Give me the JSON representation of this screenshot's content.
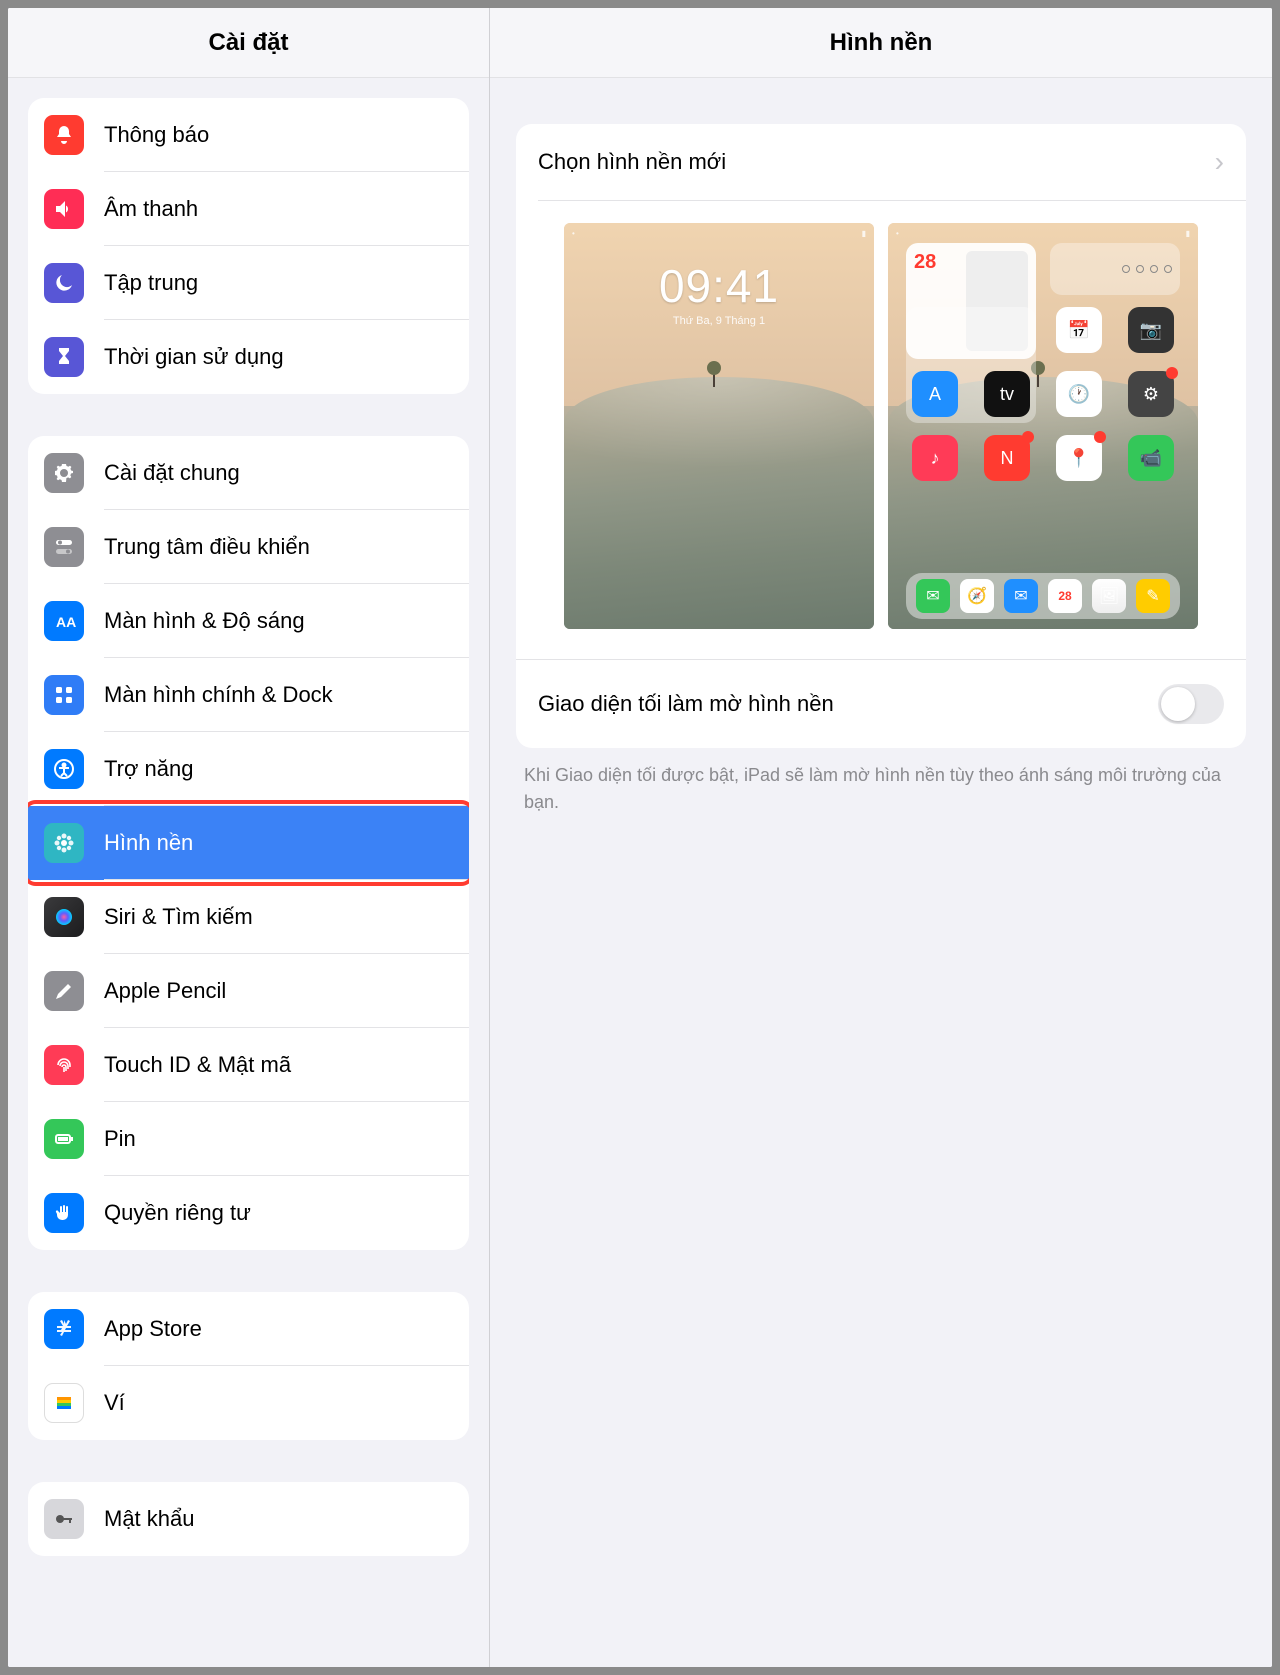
{
  "sidebar": {
    "title": "Cài đặt",
    "groups": [
      {
        "items": [
          {
            "icon": "bell-icon",
            "label": "Thông báo",
            "bg": "bg-red"
          },
          {
            "icon": "speaker-icon",
            "label": "Âm thanh",
            "bg": "bg-pink"
          },
          {
            "icon": "moon-icon",
            "label": "Tập trung",
            "bg": "bg-purple"
          },
          {
            "icon": "hourglass-icon",
            "label": "Thời gian sử dụng",
            "bg": "bg-purple"
          }
        ]
      },
      {
        "items": [
          {
            "icon": "gear-icon",
            "label": "Cài đặt chung",
            "bg": "bg-gray"
          },
          {
            "icon": "toggles-icon",
            "label": "Trung tâm điều khiển",
            "bg": "bg-gray"
          },
          {
            "icon": "textsize-icon",
            "label": "Màn hình & Độ sáng",
            "bg": "bg-blue"
          },
          {
            "icon": "grid-icon",
            "label": "Màn hình chính & Dock",
            "bg": "bg-blue2"
          },
          {
            "icon": "accessibility-icon",
            "label": "Trợ năng",
            "bg": "bg-blue"
          },
          {
            "icon": "flower-icon",
            "label": "Hình nền",
            "bg": "bg-teal",
            "selected": true,
            "highlighted": true
          },
          {
            "icon": "siri-icon",
            "label": "Siri & Tìm kiếm",
            "bg": "bg-black"
          },
          {
            "icon": "pencil-icon",
            "label": "Apple Pencil",
            "bg": "bg-gray"
          },
          {
            "icon": "fingerprint-icon",
            "label": "Touch ID & Mật mã",
            "bg": "bg-pink"
          },
          {
            "icon": "battery-icon",
            "label": "Pin",
            "bg": "bg-green"
          },
          {
            "icon": "hand-icon",
            "label": "Quyền riêng tư",
            "bg": "bg-blue"
          }
        ]
      },
      {
        "items": [
          {
            "icon": "appstore-icon",
            "label": "App Store",
            "bg": "bg-blue"
          },
          {
            "icon": "wallet-icon",
            "label": "Ví",
            "bg": "bg-white"
          }
        ]
      },
      {
        "items": [
          {
            "icon": "key-icon",
            "label": "Mật khẩu",
            "bg": "bg-grayd"
          }
        ]
      }
    ]
  },
  "detail": {
    "title": "Hình nền",
    "choose_label": "Chọn hình nền mới",
    "lock_preview": {
      "time": "09:41",
      "date": "Thứ Ba, 9 Tháng 1"
    },
    "home_preview": {
      "calendar_day": "28"
    },
    "dark_toggle": {
      "label": "Giao diện tối làm mờ hình nền",
      "on": false
    },
    "footer": "Khi Giao diện tối được bật, iPad sẽ làm mờ hình nền tùy theo ánh sáng môi trường của bạn."
  }
}
